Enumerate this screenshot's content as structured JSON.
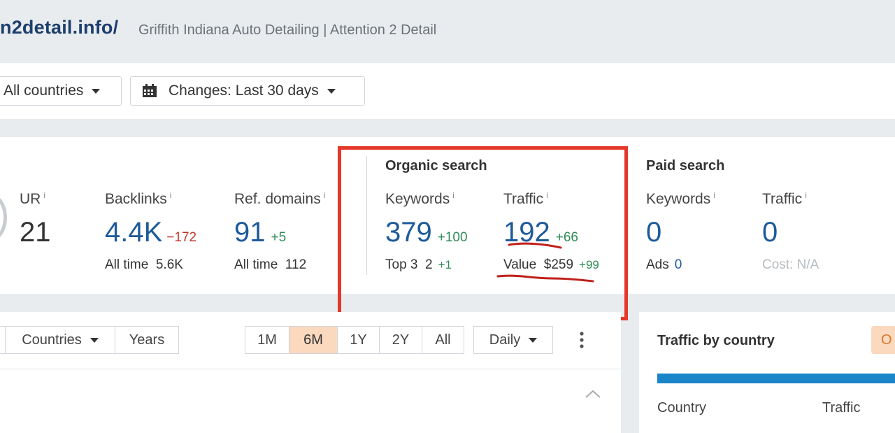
{
  "header": {
    "site_url": "n2detail.info/",
    "site_description": "Griffith Indiana Auto Detailing | Attention 2 Detail"
  },
  "filters": {
    "countries_label": "All countries",
    "changes_label": "Changes: Last 30 days",
    "calendar_icon": "calendar-icon"
  },
  "metrics": {
    "ur": {
      "label": "UR",
      "info": "i",
      "value": "21"
    },
    "backlinks": {
      "label": "Backlinks",
      "info": "i",
      "value": "4.4K",
      "delta": "−172",
      "sub_label": "All time",
      "sub_value": "5.6K"
    },
    "ref_domains": {
      "label": "Ref. domains",
      "info": "i",
      "value": "91",
      "delta": "+5",
      "sub_label": "All time",
      "sub_value": "112"
    },
    "organic": {
      "title": "Organic search",
      "keywords": {
        "label": "Keywords",
        "info": "i",
        "value": "379",
        "delta": "+100",
        "sub_label": "Top 3",
        "sub_value": "2",
        "sub_delta": "+1"
      },
      "traffic": {
        "label": "Traffic",
        "info": "i",
        "value": "192",
        "delta": "+66",
        "sub_label": "Value",
        "sub_value": "$259",
        "sub_delta": "+99"
      }
    },
    "paid": {
      "title": "Paid search",
      "keywords": {
        "label": "Keywords",
        "info": "i",
        "value": "0",
        "sub_label": "Ads",
        "sub_value": "0"
      },
      "traffic": {
        "label": "Traffic",
        "info": "i",
        "value": "0",
        "sub_label": "Cost: N/A"
      }
    }
  },
  "chart_controls": {
    "segments_left": [
      "Countries",
      "Years"
    ],
    "ranges": [
      "1M",
      "6M",
      "1Y",
      "2Y",
      "All"
    ],
    "active_range": "6M",
    "interval": "Daily",
    "more_icon": "more-vertical-icon",
    "collapse_icon": "chevron-up-icon"
  },
  "traffic_by_country": {
    "title": "Traffic by country",
    "button_label": "O",
    "columns": [
      "Country",
      "Traffic"
    ],
    "bar_color": "#1a85c8"
  },
  "colors": {
    "highlight_box": "#e5382a",
    "link_blue": "#1d5a9a",
    "positive": "#2e8b57",
    "negative": "#c0392b",
    "active_tab": "#fad9bf"
  }
}
